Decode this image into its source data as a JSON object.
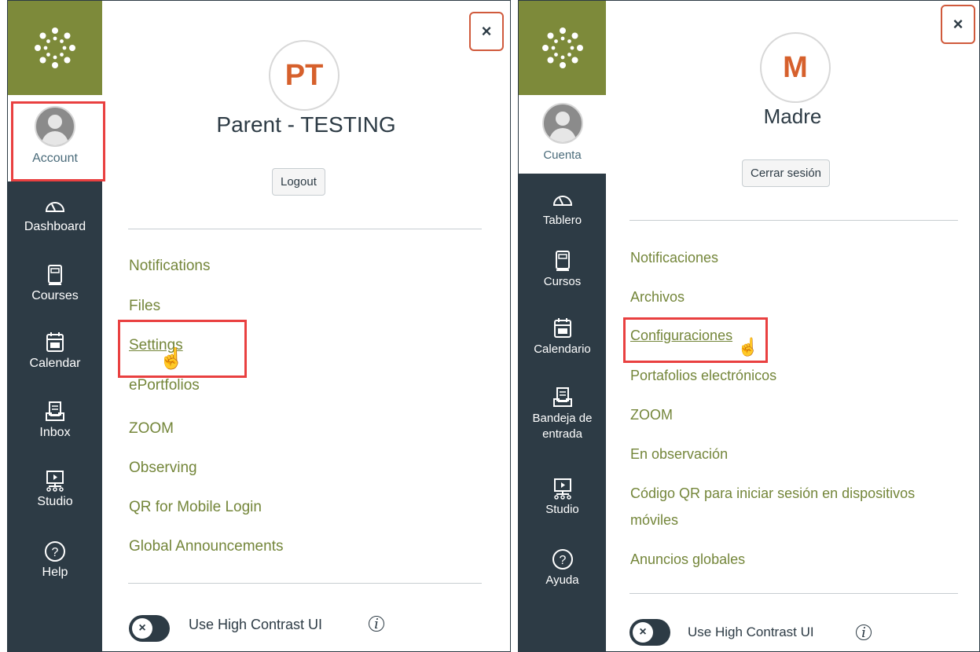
{
  "left": {
    "nav": {
      "account": "Account",
      "items": [
        {
          "label": "Dashboard",
          "icon": "dashboard-icon"
        },
        {
          "label": "Courses",
          "icon": "courses-icon"
        },
        {
          "label": "Calendar",
          "icon": "calendar-icon"
        },
        {
          "label": "Inbox",
          "icon": "inbox-icon"
        },
        {
          "label": "Studio",
          "icon": "studio-icon"
        },
        {
          "label": "Help",
          "icon": "help-icon"
        }
      ]
    },
    "user": {
      "initials": "PT",
      "name": "Parent - TESTING"
    },
    "logout": "Logout",
    "menu": [
      "Notifications",
      "Files",
      "Settings",
      "ePortfolios",
      "ZOOM",
      "Observing",
      "QR for Mobile Login",
      "Global Announcements"
    ],
    "toggle_label": "Use High Contrast UI",
    "close": "×"
  },
  "right": {
    "nav": {
      "account": "Cuenta",
      "items": [
        {
          "label": "Tablero",
          "icon": "dashboard-icon"
        },
        {
          "label": "Cursos",
          "icon": "courses-icon"
        },
        {
          "label": "Calendario",
          "icon": "calendar-icon"
        },
        {
          "label": "Bandeja de",
          "label2": "entrada",
          "icon": "inbox-icon"
        },
        {
          "label": "Studio",
          "icon": "studio-icon"
        },
        {
          "label": "Ayuda",
          "icon": "help-icon"
        }
      ]
    },
    "user": {
      "initials": "M",
      "name": "Madre"
    },
    "logout": "Cerrar sesión",
    "menu": [
      "Notificaciones",
      "Archivos",
      "Configuraciones",
      "Portafolios electrónicos",
      "ZOOM",
      "En observación",
      "Código QR para iniciar sesión en dispositivos",
      "móviles",
      "Anuncios globales"
    ],
    "toggle_label": "Use High Contrast UI",
    "close": "×"
  },
  "colors": {
    "nav_bg": "#2d3b45",
    "brand": "#7d8a3a",
    "link": "#74863a",
    "highlight": "#e94040",
    "initials": "#d6602c"
  }
}
